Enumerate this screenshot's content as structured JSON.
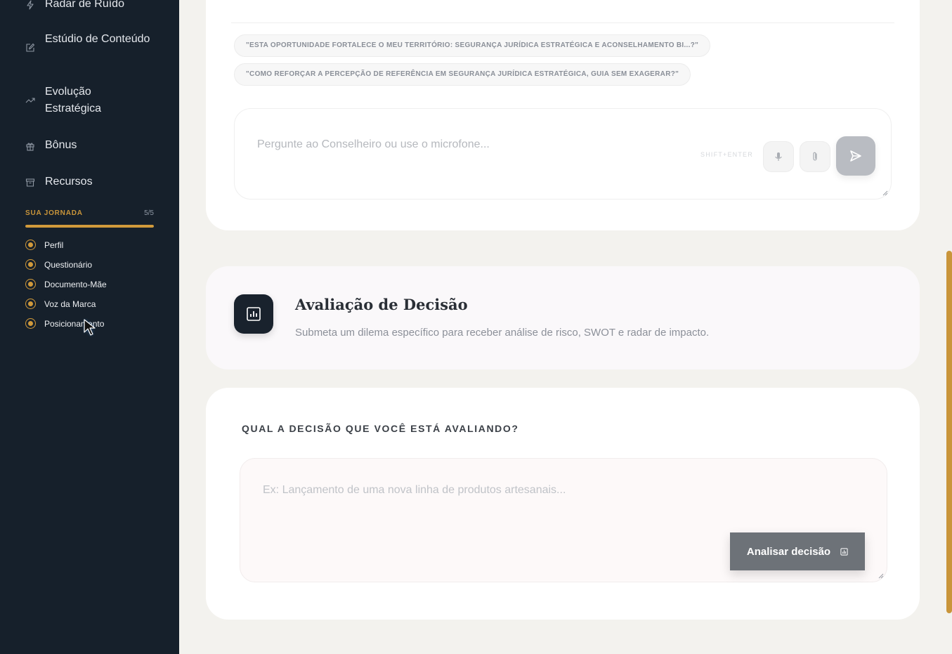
{
  "sidebar": {
    "nav": [
      {
        "label": "Radar de Ruído",
        "icon": "lightning-icon"
      },
      {
        "label": "Estúdio de Conteúdo",
        "icon": "edit-icon"
      },
      {
        "label": "Evolução Estratégica",
        "icon": "trend-up-icon"
      },
      {
        "label": "Bônus",
        "icon": "gift-icon"
      },
      {
        "label": "Recursos",
        "icon": "archive-icon"
      }
    ],
    "journey": {
      "title": "SUA JORNADA",
      "count": "5/5",
      "progress": 1.0,
      "items": [
        "Perfil",
        "Questionário",
        "Documento-Mãe",
        "Voz da Marca",
        "Posicionamento"
      ]
    }
  },
  "chat": {
    "suggestions": [
      "\"ESTA OPORTUNIDADE FORTALECE O MEU TERRITÓRIO: SEGURANÇA JURÍDICA ESTRATÉGICA E ACONSELHAMENTO BI...?\"",
      "\"COMO REFORÇAR A PERCEPÇÃO DE REFERÊNCIA EM SEGURANÇA JURÍDICA ESTRATÉGICA, GUIA SEM EXAGERAR?\""
    ],
    "placeholder": "Pergunte ao Conselheiro ou use o microfone...",
    "shortcut": "SHIFT+ENTER"
  },
  "evaluation": {
    "title": "Avaliação de Decisão",
    "subtitle": "Submeta um dilema específico para receber análise de risco, SWOT e radar de impacto."
  },
  "decision": {
    "label": "QUAL A DECISÃO QUE VOCÊ ESTÁ AVALIANDO?",
    "placeholder": "Ex: Lançamento de uma nova linha de produtos artesanais...",
    "button": "Analisar decisão"
  },
  "colors": {
    "sidebar": "#16202b",
    "accent": "#d19a3b",
    "background": "#f3f2ee"
  }
}
